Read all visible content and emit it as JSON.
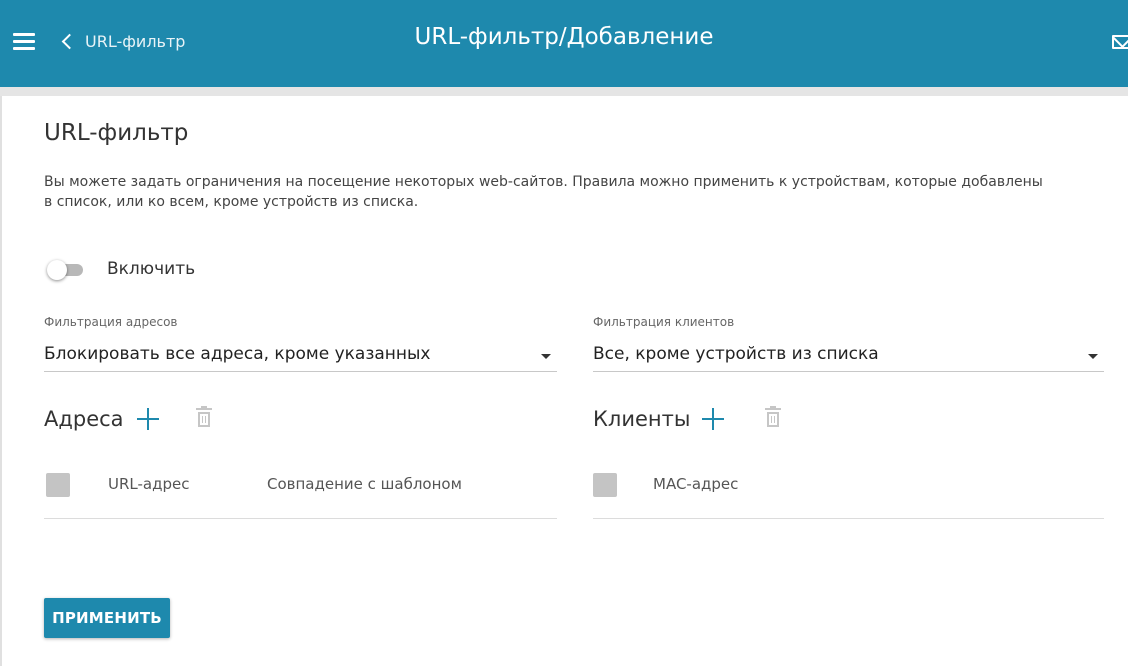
{
  "header": {
    "back_label": "URL-фильтр",
    "title": "URL-фильтр/Добавление"
  },
  "section": {
    "title": "URL-фильтр",
    "description": "Вы можете задать ограничения на посещение некоторых web-сайтов. Правила можно применить к устройствам, которые добавлены в список, или ко всем, кроме устройств из списка."
  },
  "enable": {
    "label": "Включить",
    "checked": false
  },
  "address_filter": {
    "label": "Фильтрация адресов",
    "value": "Блокировать все адреса, кроме указанных"
  },
  "client_filter": {
    "label": "Фильтрация клиентов",
    "value": "Все, кроме устройств из списка"
  },
  "addresses": {
    "title": "Адреса",
    "columns": [
      "URL-адрес",
      "Совпадение с шаблоном"
    ]
  },
  "clients": {
    "title": "Клиенты",
    "columns": [
      "MAC-адрес"
    ]
  },
  "apply_label": "ПРИМЕНИТЬ",
  "colors": {
    "accent": "#1e89ad",
    "toggle_off": "#b8b8b8",
    "checkbox": "#c4c4c4"
  },
  "icons": [
    "menu-icon",
    "chevron-left-icon",
    "mail-icon",
    "plus-icon",
    "trash-icon"
  ]
}
